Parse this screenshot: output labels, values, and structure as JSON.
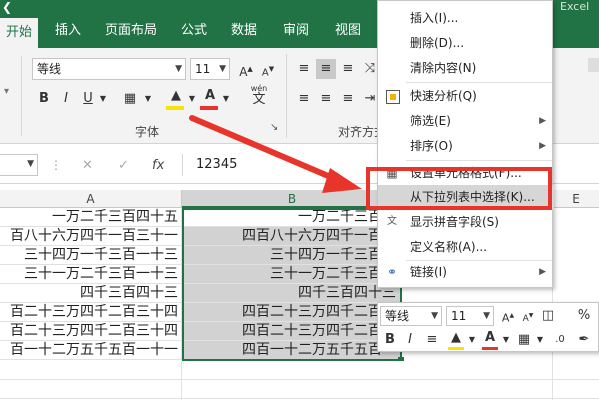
{
  "tabs": [
    "开始",
    "插入",
    "页面布局",
    "公式",
    "数据",
    "审阅",
    "视图"
  ],
  "app_label": "Excel",
  "ribbon": {
    "font_name": "等线",
    "font_size": "11",
    "bold": "B",
    "italic": "I",
    "underline": "U",
    "font_group_label": "字体",
    "align_group_label": "对齐方式",
    "phonetic": "wén",
    "phonetic_char": "文",
    "font_color_glyph": "A",
    "font_color": "#e8352b",
    "fill_color": "#f5e600"
  },
  "formula_bar": {
    "cancel": "✕",
    "enter": "✓",
    "fx": "fx",
    "value": "12345"
  },
  "columns": {
    "a": "A",
    "b": "B",
    "e": "E"
  },
  "rows": {
    "col_a": [
      "一万二千三百四十五",
      "百八十六万四千一百三十一",
      "三十四万一千三百一十三",
      "三十一万二千三百一十三",
      "四千三百四十三",
      "百二十三万四千二百三十四",
      "百二十三万四千二百三十四",
      "百一十二万五千五百一十一"
    ],
    "col_b": [
      "一万二千三百四",
      "四百八十六万四千一百三",
      "三十四万一千三百一",
      "三十一万二千三百一",
      "四千三百四十三",
      "四百二十三万四千二百三",
      "四百二十三万四千二百三",
      "四百一十二万五千五百一"
    ]
  },
  "context_menu": {
    "items": [
      {
        "label": "插入(I)...",
        "icon": ""
      },
      {
        "label": "删除(D)...",
        "icon": ""
      },
      {
        "label": "清除内容(N)",
        "icon": ""
      },
      {
        "label": "快速分析(Q)",
        "icon": "quick-analysis-icon"
      },
      {
        "label": "筛选(E)",
        "icon": ""
      },
      {
        "label": "排序(O)",
        "icon": ""
      },
      {
        "label": "设置单元格格式(F)...",
        "icon": "format-cells-icon"
      },
      {
        "label": "从下拉列表中选择(K)...",
        "icon": ""
      },
      {
        "label": "显示拼音字段(S)",
        "icon": "phonetic-icon"
      },
      {
        "label": "定义名称(A)...",
        "icon": ""
      },
      {
        "label": "链接(I)",
        "icon": "link-icon"
      }
    ]
  },
  "mini_toolbar": {
    "font_name": "等线",
    "font_size": "11",
    "bold": "B",
    "italic": "I",
    "percent": "%"
  },
  "annotation_color": "#e8352b"
}
